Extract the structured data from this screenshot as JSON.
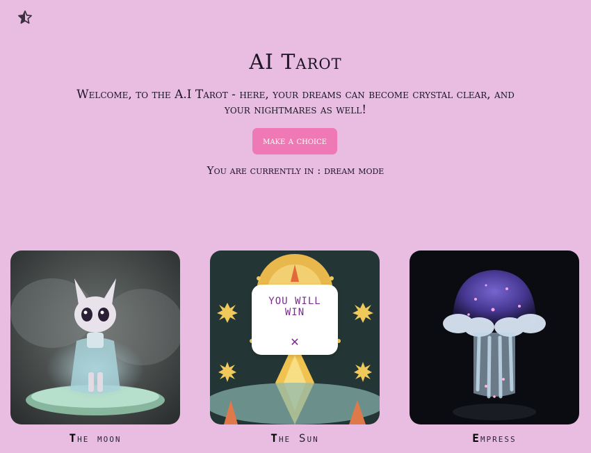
{
  "header": {
    "title": "AI Tarot",
    "welcome": "Welcome, to the A.I Tarot - here, your dreams can become crystal clear, and your nightmares as well!",
    "choice_button": "make a choice",
    "mode_text": "You are currently in : dream mode",
    "star_icon": "half-star-icon"
  },
  "cards": [
    {
      "label": "The moon",
      "image": "ghost-creature-figurine"
    },
    {
      "label": "The Sun",
      "image": "sun-tarot-illustration"
    },
    {
      "label": "Empress",
      "image": "glowing-jellyfish-figurine"
    }
  ],
  "popup": {
    "text": "You will win",
    "close_icon": "close-icon"
  }
}
